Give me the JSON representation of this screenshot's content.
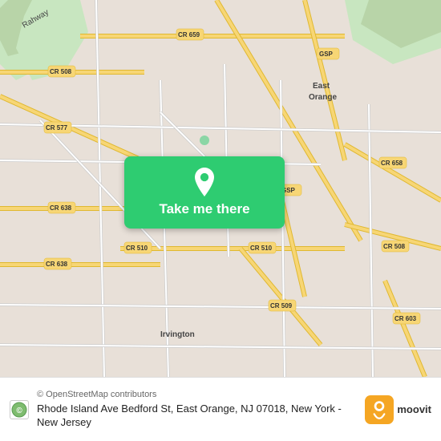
{
  "map": {
    "alt": "Map of East Orange, New Jersey area"
  },
  "button": {
    "label": "Take me there"
  },
  "bottom": {
    "osm_credit": "© OpenStreetMap contributors",
    "address": "Rhode Island Ave Bedford St, East Orange, NJ 07018, New York - New Jersey"
  },
  "branding": {
    "name": "moovit"
  },
  "roads": {
    "accent": "#f7d675",
    "background": "#e8e0d8"
  }
}
